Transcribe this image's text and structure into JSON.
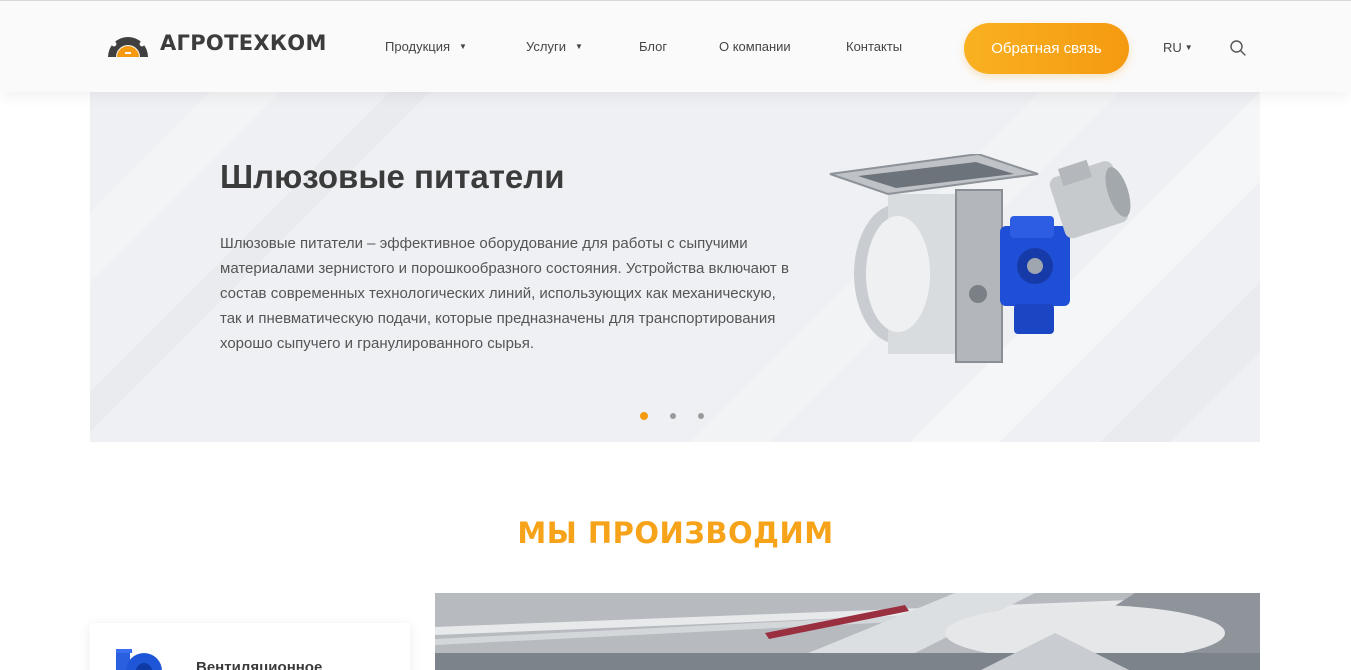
{
  "header": {
    "brand": "АГРОТЕХКОМ",
    "nav": [
      {
        "label": "Продукция",
        "has_dropdown": true
      },
      {
        "label": "Услуги",
        "has_dropdown": true
      },
      {
        "label": "Блог",
        "has_dropdown": false
      },
      {
        "label": "О компании",
        "has_dropdown": false
      },
      {
        "label": "Контакты",
        "has_dropdown": false
      }
    ],
    "feedback_label": "Обратная связь",
    "language": "RU",
    "search_icon": "search-icon"
  },
  "hero": {
    "title": "Шлюзовые питатели",
    "description": "Шлюзовые питатели – эффективное оборудование для работы с сыпучими материалами зернистого и порошкообразного состояния. Устройства включают в состав современных технологических линий, использующих как механическую, так и пневматическую подачи, которые предназначены для транспортирования хорошо сыпучего и гранулированного сырья.",
    "slides_total": 3,
    "active_slide": 1
  },
  "section": {
    "title": "МЫ ПРОИЗВОДИМ",
    "card_label": "Вентиляционное"
  },
  "colors": {
    "accent": "#f59a10",
    "accent_light": "#f9b121",
    "heading": "#3b3b3b"
  }
}
